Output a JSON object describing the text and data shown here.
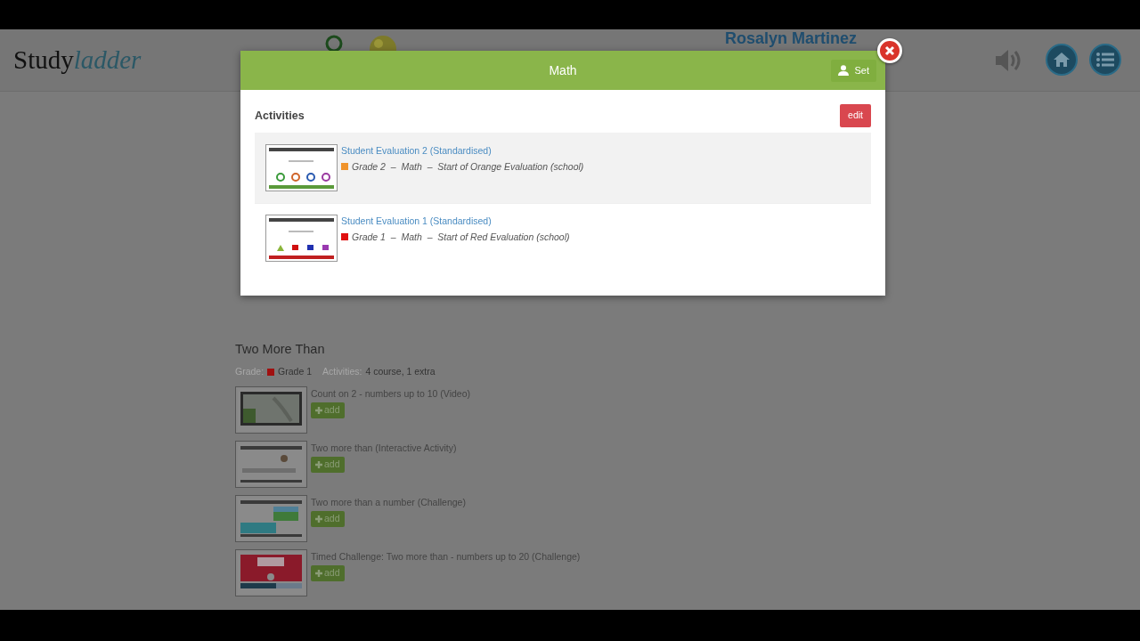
{
  "header": {
    "logo": {
      "main": "Study",
      "accent": "ladder"
    },
    "user_name": "Rosalyn Martinez"
  },
  "modal": {
    "title": "Math",
    "set_button": "Set",
    "section_title": "Activities",
    "edit_button": "edit",
    "activities": [
      {
        "title": "Student Evaluation 2 (Standardised)",
        "meta": "Grade 2  –  Math  –  Start of Orange Evaluation (school)",
        "color": "#f0932b",
        "highlighted": true,
        "kind": "clocks"
      },
      {
        "title": "Student Evaluation 1 (Standardised)",
        "meta": "Grade 1  –  Math  –  Start of Red Evaluation (school)",
        "color": "#e01010",
        "highlighted": false,
        "kind": "shapes"
      }
    ]
  },
  "unit": {
    "title": "Two More Than",
    "grade_label": "Grade:",
    "grade": "Grade 1",
    "color": "#a01010",
    "activities_label": "Activities:",
    "activities_count": "4 course, 1 extra",
    "items": [
      {
        "title": "Count on 2 - numbers up to 10 (Video)",
        "add_label": "add"
      },
      {
        "title": "Two more than (Interactive Activity)",
        "add_label": "add"
      },
      {
        "title": "Two more than a number (Challenge)",
        "add_label": "add"
      },
      {
        "title": "Timed Challenge: Two more than - numbers up to 20 (Challenge)",
        "add_label": "add"
      }
    ]
  }
}
